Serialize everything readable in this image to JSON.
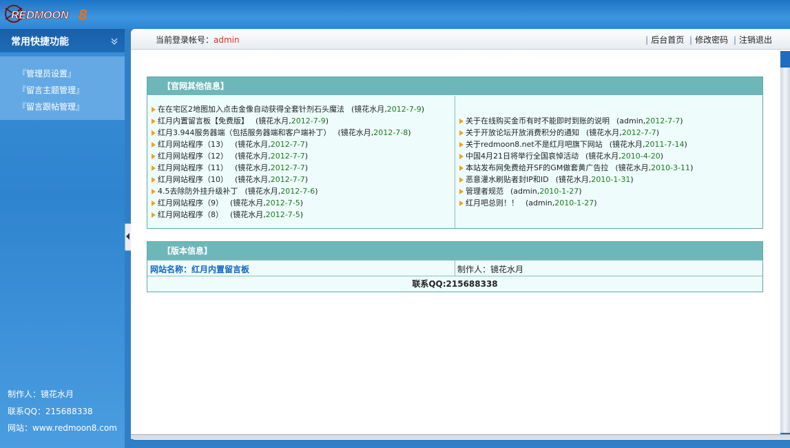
{
  "brand": {
    "logo_text": "REDMOON8"
  },
  "sidebar": {
    "title": "常用快捷功能",
    "menu": [
      {
        "label": "『管理员设置』"
      },
      {
        "label": "『留言主题管理』"
      },
      {
        "label": "『留言跟帖管理』"
      }
    ],
    "footer": {
      "author": "制作人：镜花水月",
      "qq": "联系QQ：215688338",
      "site": "网站：www.redmoon8.com"
    }
  },
  "header": {
    "login_label": "当前登录帐号：",
    "login_user": "admin",
    "links": [
      "后台首页",
      "修改密码",
      "注销退出"
    ]
  },
  "news": {
    "title": "【官网其他信息】",
    "left": [
      {
        "title": "在在宅区2地图加入点击金像自动获得全套针剂石头魔法",
        "author": "镜花水月",
        "date": "2012-7-9"
      },
      {
        "title": "红月内置留言板【免费版】",
        "author": "镜花水月",
        "date": "2012-7-9"
      },
      {
        "title": "红月3.944服务器端（包括服务器端和客户端补丁）",
        "author": "镜花水月",
        "date": "2012-7-8"
      },
      {
        "title": "红月网站程序（13）",
        "author": "镜花水月",
        "date": "2012-7-7"
      },
      {
        "title": "红月网站程序（12）",
        "author": "镜花水月",
        "date": "2012-7-7"
      },
      {
        "title": "红月网站程序（11）",
        "author": "镜花水月",
        "date": "2012-7-7"
      },
      {
        "title": "红月网站程序（10）",
        "author": "镜花水月",
        "date": "2012-7-7"
      },
      {
        "title": "4.5去除防外挂升级补丁",
        "author": "镜花水月",
        "date": "2012-7-6"
      },
      {
        "title": "红月网站程序（9）",
        "author": "镜花水月",
        "date": "2012-7-5"
      },
      {
        "title": "红月网站程序（8）",
        "author": "镜花水月",
        "date": "2012-7-5"
      }
    ],
    "right": [
      {
        "title": "关于在线购买金币有时不能即时到账的说明",
        "author": "admin",
        "date": "2012-7-7"
      },
      {
        "title": "关于开放论坛开放消费积分的通知",
        "author": "镜花水月",
        "date": "2012-7-7"
      },
      {
        "title": "关于redmoon8.net不是红月吧旗下网站",
        "author": "镜花水月",
        "date": "2011-7-14"
      },
      {
        "title": "中国4月21日将举行全国哀悼活动",
        "author": "镜花水月",
        "date": "2010-4-20"
      },
      {
        "title": "本站发布网免费给开SF的GM做套黄广告拉",
        "author": "镜花水月",
        "date": "2010-3-11"
      },
      {
        "title": "恶意灌水刷贴者封IP和ID",
        "author": "镜花水月",
        "date": "2010-1-31"
      },
      {
        "title": "管理者规范",
        "author": "admin",
        "date": "2010-1-27"
      },
      {
        "title": "红月吧总则！！",
        "author": "admin",
        "date": "2010-1-27"
      }
    ]
  },
  "version": {
    "title": "【版本信息】",
    "site_name": "网站名称：红月内置留言板",
    "author": "制作人：镜花水月",
    "contact": "联系QQ:215688338"
  },
  "colors": {
    "accent": "#6eb7b8",
    "link": "#1264c6",
    "date": "#1a7a1a",
    "user": "#e0301e",
    "bullet": "#f0a020"
  }
}
